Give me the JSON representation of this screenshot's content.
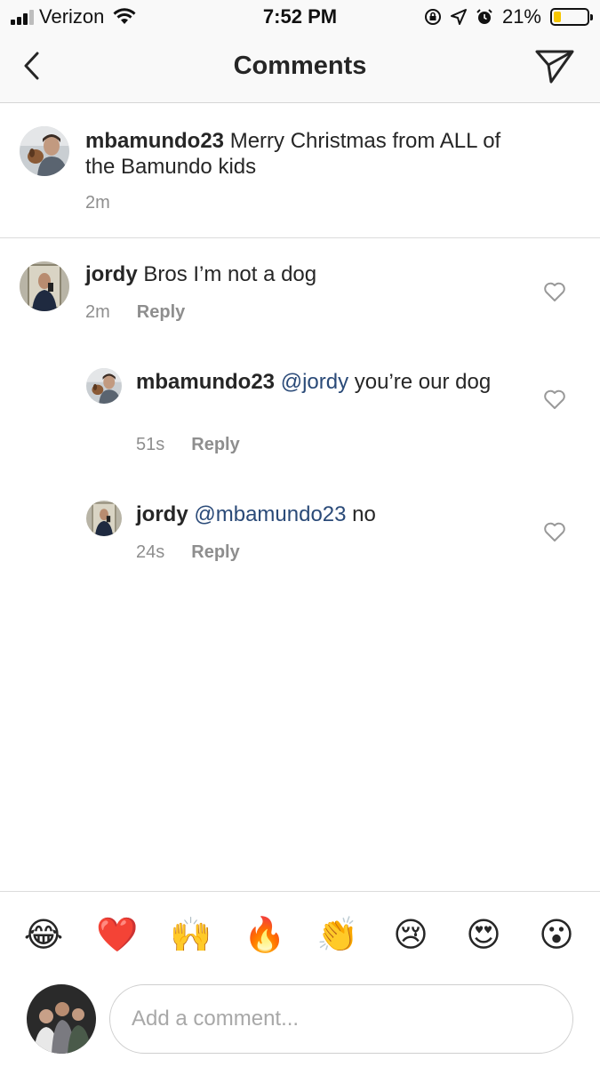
{
  "status_bar": {
    "carrier": "Verizon",
    "time": "7:52 PM",
    "battery_percent": "21%",
    "battery_level": 0.21
  },
  "nav": {
    "title": "Comments",
    "back_icon": "chevron-left-icon",
    "send_icon": "paper-plane-icon"
  },
  "caption": {
    "username": "mbamundo23",
    "text": "Merry Christmas from ALL of the Bamundo kids",
    "time": "2m"
  },
  "comments": [
    {
      "username": "jordy",
      "text": "Bros I’m not a dog",
      "mention": "",
      "time": "2m",
      "reply_label": "Reply"
    },
    {
      "username": "mbamundo23",
      "mention": "@jordy",
      "text": " you’re our dog",
      "time": "51s",
      "reply_label": "Reply"
    },
    {
      "username": "jordy",
      "mention": "@mbamundo23",
      "text": " no",
      "time": "24s",
      "reply_label": "Reply"
    }
  ],
  "emoji_bar": [
    "😂",
    "❤️",
    "🙌",
    "🔥",
    "👏",
    "😢",
    "😍",
    "😮"
  ],
  "compose": {
    "placeholder": "Add a comment..."
  },
  "colors": {
    "mention": "#2a4a78",
    "meta": "#8e8e8e",
    "battery_fill": "#f6c600"
  }
}
